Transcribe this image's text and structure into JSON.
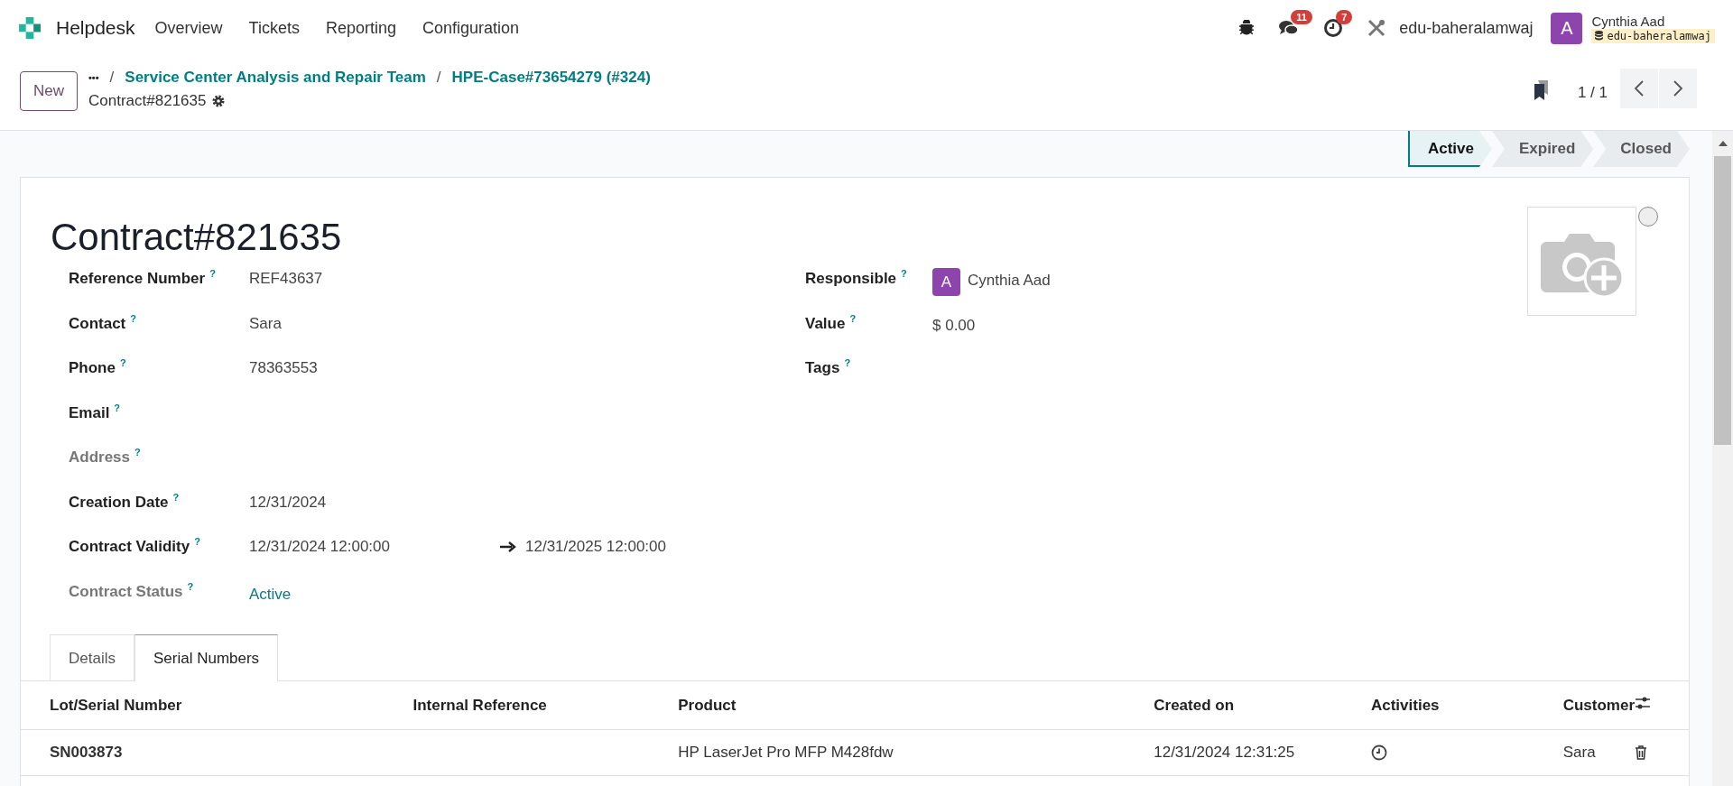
{
  "navbar": {
    "app_name": "Helpdesk",
    "menu": [
      "Overview",
      "Tickets",
      "Reporting",
      "Configuration"
    ],
    "messages_badge": "11",
    "activities_badge": "7",
    "database": "edu-baheralamwaj",
    "user": {
      "avatar_letter": "A",
      "name": "Cynthia Aad",
      "database_tag": "edu-baheralamwaj"
    }
  },
  "control_panel": {
    "new_button": "New",
    "more": "•••",
    "separator": "/",
    "breadcrumbs": [
      "Service Center Analysis and Repair Team",
      "HPE-Case#73654279 (#324)"
    ],
    "record_name": "Contract#821635",
    "pager": "1 / 1"
  },
  "statusbar": [
    {
      "label": "Active",
      "selected": true
    },
    {
      "label": "Expired",
      "selected": false
    },
    {
      "label": "Closed",
      "selected": false
    }
  ],
  "form": {
    "title": "Contract#821635",
    "priority_checked": false,
    "left_fields": [
      {
        "label": "Reference Number",
        "readonly": false,
        "kind": "text",
        "value": "REF43637"
      },
      {
        "label": "Contact",
        "readonly": false,
        "kind": "text",
        "value": "Sara"
      },
      {
        "label": "Phone",
        "readonly": false,
        "kind": "text",
        "value": "78363553"
      },
      {
        "label": "Email",
        "readonly": false,
        "kind": "text"
      },
      {
        "label": "Address",
        "readonly": true,
        "kind": "text"
      },
      {
        "label": "Creation Date",
        "readonly": false,
        "kind": "text",
        "value": "12/31/2024"
      },
      {
        "label": "Contract Validity",
        "readonly": false,
        "kind": "range",
        "value": "12/31/2024 12:00:00",
        "end": "12/31/2025 12:00:00"
      },
      {
        "label": "Contract Status",
        "readonly": true,
        "kind": "status",
        "value": "Active"
      }
    ],
    "right_fields": [
      {
        "label": "Responsible",
        "kind": "user",
        "avatar_letter": "A",
        "value": "Cynthia Aad"
      },
      {
        "label": "Value",
        "kind": "text",
        "value": "$ 0.00"
      },
      {
        "label": "Tags",
        "kind": "text"
      }
    ],
    "help_mark": "?",
    "tabs": [
      {
        "label": "Details",
        "selected": false
      },
      {
        "label": "Serial Numbers",
        "selected": true
      }
    ],
    "table": {
      "columns": [
        "Lot/Serial Number",
        "Internal Reference",
        "Product",
        "Created on",
        "Activities",
        "Customer"
      ],
      "rows": [
        {
          "lot": "SN003873",
          "internal_reference": "",
          "product": "HP LaserJet Pro MFP M428fdw",
          "created_on": "12/31/2024 12:31:25",
          "customer": "Sara"
        }
      ]
    }
  }
}
